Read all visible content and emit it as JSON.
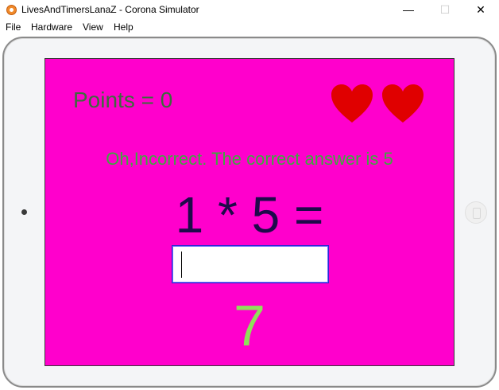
{
  "window": {
    "title": "LivesAndTimersLanaZ - Corona Simulator",
    "minimize": "—",
    "maximize": "☐",
    "close": "✕"
  },
  "menu": [
    "File",
    "Hardware",
    "View",
    "Help"
  ],
  "game": {
    "points_label": "Points = 0",
    "lives": 2,
    "feedback": "Oh,Incorrect. The correct answer is 5",
    "equation": "1 * 5 =",
    "answer_value": "",
    "timer": "7"
  },
  "colors": {
    "background": "#ff00cc",
    "points": "#3d6b3d",
    "feedback": "#3ea83e",
    "equation": "#1e0a4a",
    "timer": "#8fe05a",
    "heart": "#e00000"
  }
}
